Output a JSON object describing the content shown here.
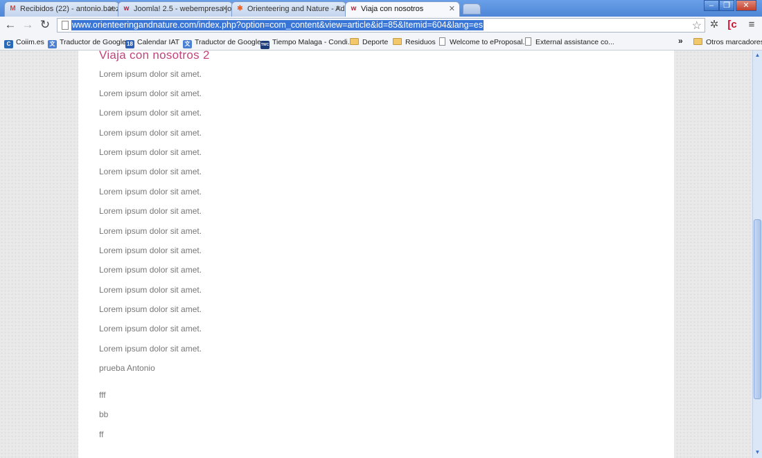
{
  "tabs": [
    {
      "label": "Recibidos (22) - antonio.baez",
      "icon": "gmail-icon",
      "glyph": "M",
      "glyph_color": "#d44638",
      "active": false
    },
    {
      "label": "Joomla! 2.5 - webempresa jo",
      "icon": "webempresa-icon",
      "glyph": "w",
      "glyph_color": "#c8102e",
      "active": false
    },
    {
      "label": "Orienteering and Nature - Ad",
      "icon": "joomla-icon",
      "glyph": "✱",
      "glyph_color": "#e8632b",
      "active": false
    },
    {
      "label": "Viaja con nosotros",
      "icon": "webempresa-icon",
      "glyph": "w",
      "glyph_color": "#c8102e",
      "active": true
    }
  ],
  "address_bar": {
    "url": "www.orienteeringandnature.com/index.php?option=com_content&view=article&id=85&Itemid=604&lang=es"
  },
  "bookmarks": [
    {
      "label": "Coiim.es",
      "icon": "coiim-icon",
      "glyph": "C",
      "color": "#2a6ab8"
    },
    {
      "label": "Traductor de Google",
      "icon": "google-translate-icon",
      "glyph": "文",
      "color": "#4a7fd4"
    },
    {
      "label": "Calendar IAT",
      "icon": "calendar-icon",
      "glyph": "18",
      "color": "#2c5fb5"
    },
    {
      "label": "Traductor de Google",
      "icon": "google-translate-icon",
      "glyph": "文",
      "color": "#4a7fd4"
    },
    {
      "label": "Tiempo Malaga - Condi...",
      "icon": "twc-icon",
      "glyph": "TWC",
      "color": "#1d3b77"
    },
    {
      "label": "Deporte",
      "icon": "folder-icon"
    },
    {
      "label": "Residuos",
      "icon": "folder-icon"
    },
    {
      "label": "Welcome to eProposal.",
      "icon": "page-icon"
    },
    {
      "label": "External assistance co...",
      "icon": "page-icon"
    }
  ],
  "bookmarks_overflow": "»",
  "other_bookmarks": "Otros marcadores",
  "article": {
    "title": "Viaja con nosotros 2",
    "paragraphs": [
      "Lorem ipsum dolor sit amet.",
      "Lorem ipsum dolor sit amet.",
      "Lorem ipsum dolor sit amet.",
      "Lorem ipsum dolor sit amet.",
      "Lorem ipsum dolor sit amet.",
      "Lorem ipsum dolor sit amet.",
      "Lorem ipsum dolor sit amet.",
      "Lorem ipsum dolor sit amet.",
      "Lorem ipsum dolor sit amet.",
      "Lorem ipsum dolor sit amet.",
      "Lorem ipsum dolor sit amet.",
      "Lorem ipsum dolor sit amet.",
      "Lorem ipsum dolor sit amet.",
      "Lorem ipsum dolor sit amet.",
      "Lorem ipsum dolor sit amet.",
      "prueba Antonio",
      "fff",
      "bb",
      "ff"
    ]
  }
}
